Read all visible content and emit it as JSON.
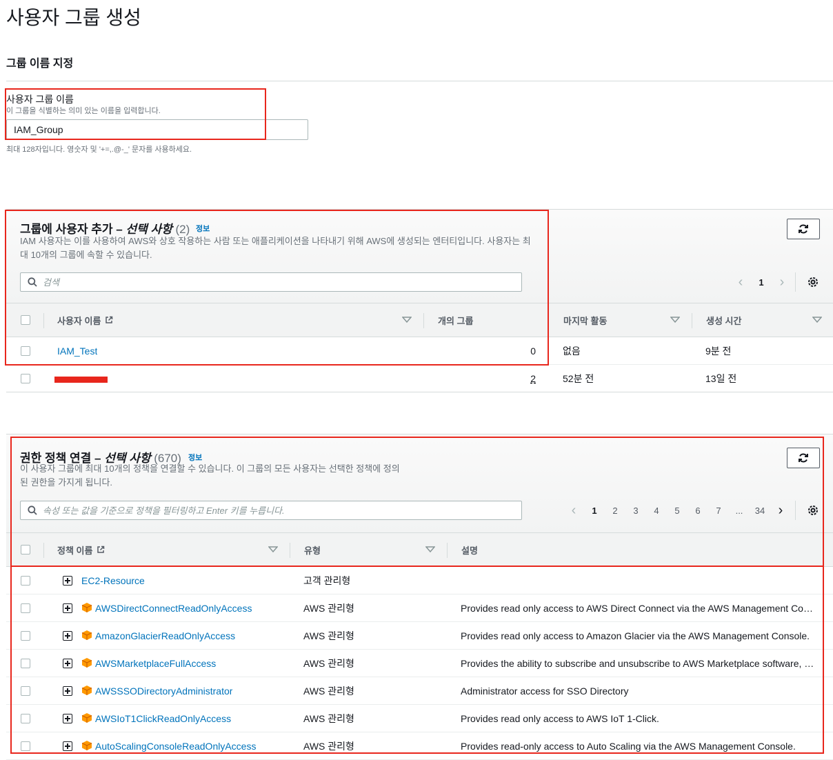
{
  "page": {
    "title": "사용자 그룹 생성"
  },
  "name_section": {
    "title": "그룹 이름 지정",
    "label": "사용자 그룹 이름",
    "description": "이 그룹을 식별하는 의미 있는 이름을 입력합니다.",
    "value": "IAM_Group",
    "hint": "최대 128자입니다. 영숫자 및 '+=,.@-_' 문자를 사용하세요."
  },
  "users_panel": {
    "title_main": "그룹에 사용자 추가 – ",
    "title_optional": "선택 사항",
    "count": " (2)",
    "info": "정보",
    "description_line1": "IAM 사용자는 이를 사용하여 AWS와 상호 작용하는 사람 또는 애플리케이션을 나타내기 위해 AWS에 생성되는 엔터티입니다. 사용자는 최",
    "description_line2": "대 10개의 그룹에 속할 수 있습니다.",
    "search_placeholder": "검색",
    "page": "1",
    "columns": {
      "name": "사용자 이름",
      "groups": "개의 그룹",
      "last_activity": "마지막 활동",
      "created": "생성 시간"
    },
    "rows": [
      {
        "name": "IAM_Test",
        "groups": "0",
        "last_activity": "없음",
        "created": "9분 전"
      },
      {
        "name": "",
        "groups": "2",
        "last_activity": "52분 전",
        "created": "13일 전"
      }
    ]
  },
  "policies_panel": {
    "title_main": "권한 정책 연결 – ",
    "title_optional": "선택 사항",
    "count": " (670)",
    "info": "정보",
    "description_line1": "이 사용자 그룹에 최대 10개의 정책을 연결할 수 있습니다. 이 그룹의 모든 사용자는 선택한 정책에 정의",
    "description_line2": "된 권한을 가지게 됩니다.",
    "search_placeholder": "속성 또는 값을 기준으로 정책을 필터링하고 Enter 키를 누릅니다.",
    "pages": [
      "1",
      "2",
      "3",
      "4",
      "5",
      "6",
      "7",
      "...",
      "34"
    ],
    "columns": {
      "name": "정책 이름",
      "type": "유형",
      "description": "설명"
    },
    "rows": [
      {
        "name": "EC2-Resource",
        "type": "고객 관리형",
        "description": "",
        "aws": false
      },
      {
        "name": "AWSDirectConnectReadOnlyAccess",
        "type": "AWS 관리형",
        "description": "Provides read only access to AWS Direct Connect via the AWS Management Co…",
        "aws": true
      },
      {
        "name": "AmazonGlacierReadOnlyAccess",
        "type": "AWS 관리형",
        "description": "Provides read only access to Amazon Glacier via the AWS Management Console.",
        "aws": true
      },
      {
        "name": "AWSMarketplaceFullAccess",
        "type": "AWS 관리형",
        "description": "Provides the ability to subscribe and unsubscribe to AWS Marketplace software, …",
        "aws": true
      },
      {
        "name": "AWSSSODirectoryAdministrator",
        "type": "AWS 관리형",
        "description": "Administrator access for SSO Directory",
        "aws": true
      },
      {
        "name": "AWSIoT1ClickReadOnlyAccess",
        "type": "AWS 관리형",
        "description": "Provides read only access to AWS IoT 1-Click.",
        "aws": true
      },
      {
        "name": "AutoScalingConsoleReadOnlyAccess",
        "type": "AWS 관리형",
        "description": "Provides read-only access to Auto Scaling via the AWS Management Console.",
        "aws": true
      }
    ]
  },
  "colors": {
    "accent_link": "#0073bb",
    "highlight_border": "#e8261c",
    "header_bg": "#f2f3f3",
    "aws_icon": "#ff9900"
  }
}
